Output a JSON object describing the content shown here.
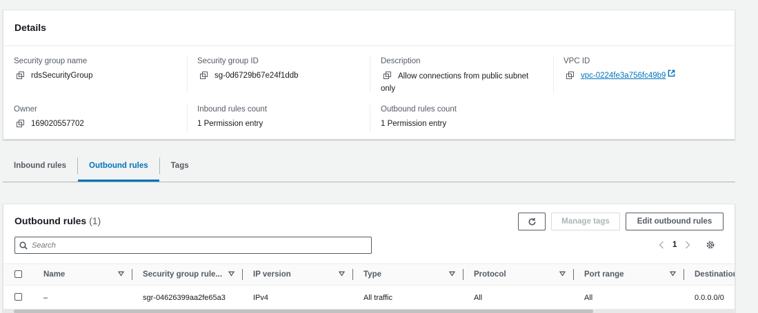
{
  "details": {
    "title": "Details",
    "sg_name_label": "Security group name",
    "sg_name": "rdsSecurityGroup",
    "sg_id_label": "Security group ID",
    "sg_id": "sg-0d6729b67e24f1ddb",
    "description_label": "Description",
    "description": "Allow connections from public subnet only",
    "vpc_label": "VPC ID",
    "vpc_id": "vpc-0224fe3a756fc49b9",
    "owner_label": "Owner",
    "owner": "169020557702",
    "inbound_count_label": "Inbound rules count",
    "inbound_count": "1 Permission entry",
    "outbound_count_label": "Outbound rules count",
    "outbound_count": "1 Permission entry"
  },
  "tabs": [
    {
      "label": "Inbound rules",
      "active": false
    },
    {
      "label": "Outbound rules",
      "active": true
    },
    {
      "label": "Tags",
      "active": false
    }
  ],
  "rules": {
    "title": "Outbound rules",
    "count": "(1)",
    "refresh_icon": "refresh-icon",
    "manage_tags_label": "Manage tags",
    "edit_label": "Edit outbound rules",
    "search_placeholder": "Search",
    "page": "1",
    "columns": [
      "Name",
      "Security group rule...",
      "IP version",
      "Type",
      "Protocol",
      "Port range",
      "Destination"
    ],
    "rows": [
      {
        "name": "–",
        "rule_id": "sgr-04626399aa2fe65a3",
        "ip_version": "IPv4",
        "type": "All traffic",
        "protocol": "All",
        "port_range": "All",
        "destination": "0.0.0.0/0"
      }
    ]
  },
  "colors": {
    "accent": "#0073bb",
    "text": "#16191f",
    "muted": "#545b64",
    "background": "#f2f3f3"
  }
}
